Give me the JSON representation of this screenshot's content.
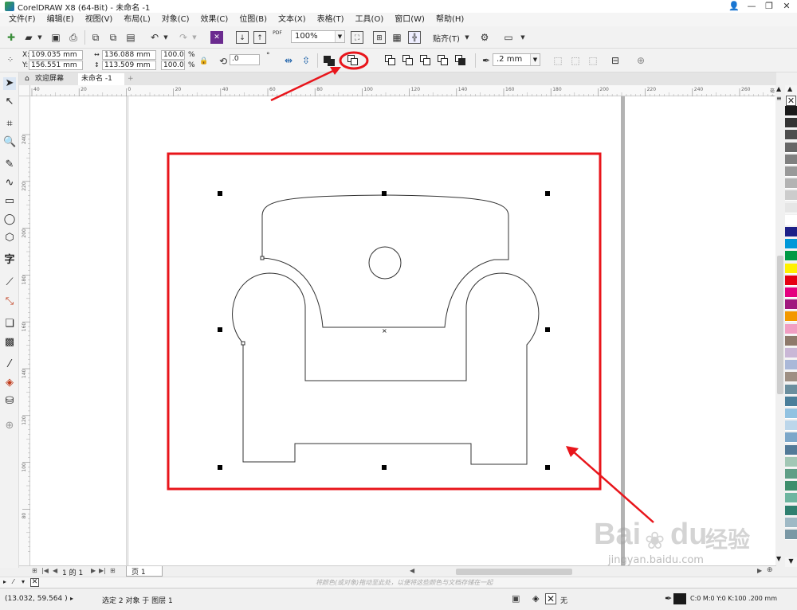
{
  "window": {
    "title": "CorelDRAW X8 (64-Bit) - 未命名 -1",
    "controls": [
      "👤",
      "—",
      "❐",
      "✕"
    ]
  },
  "menu": [
    "文件(F)",
    "编辑(E)",
    "视图(V)",
    "布局(L)",
    "对象(C)",
    "效果(C)",
    "位图(B)",
    "文本(X)",
    "表格(T)",
    "工具(O)",
    "窗口(W)",
    "帮助(H)"
  ],
  "standard_toolbar": {
    "zoom_value": "100%",
    "snap_label": "贴齐(T)",
    "pdf_label": "PDF"
  },
  "property_bar": {
    "x_label": "X:",
    "x_value": "109.035 mm",
    "y_label": "Y:",
    "y_value": "156.551 mm",
    "w_value": "136.088 mm",
    "h_value": "113.509 mm",
    "sx_value": "100.0",
    "sy_value": "100.0",
    "pct": "%",
    "rotation_value": ".0",
    "degree": "°",
    "outline_width": ".2 mm"
  },
  "doc_tabs": {
    "welcome": "欢迎屏幕",
    "document": "未命名 -1",
    "add": "+"
  },
  "ruler_h": [
    "40",
    "20",
    "0",
    "20",
    "40",
    "60",
    "80",
    "100",
    "120",
    "140",
    "160",
    "180",
    "200",
    "220",
    "240",
    "260"
  ],
  "ruler_v": [
    "240",
    "220",
    "200",
    "180",
    "160",
    "140",
    "120",
    "100",
    "80"
  ],
  "ruler_h_unit": "毫米",
  "page_nav": {
    "page_info": "1 的 1",
    "page_tab": "页 1"
  },
  "color_strip_hint": "将颜色(或对象)拖动至此处，以便将这些颜色与文档存储在一起",
  "status": {
    "coords": "(13.032, 59.564 )",
    "selection_text": "选定 2 对象 于 图层 1",
    "fill_none": "无",
    "color_info": "C:0 M:0 Y:0 K:100  .200 mm"
  },
  "watermark": {
    "brand": "Bai",
    "brand2": "du",
    "sub": "经验",
    "url": "jingyan.baidu.com"
  },
  "colors": {
    "annotation_red": "#e8151b",
    "palette": [
      "#1a1a1a",
      "#333333",
      "#4d4d4d",
      "#666666",
      "#808080",
      "#999999",
      "#b3b3b3",
      "#cccccc",
      "#e6e6e6",
      "#ffffff",
      "#1d2088",
      "#0098d8",
      "#009944",
      "#fff100",
      "#e60012",
      "#e4007f",
      "#a0197e",
      "#f39800",
      "#f19ec2",
      "#8e7a6b",
      "#c9b7d6",
      "#aab8d8",
      "#9e8f83",
      "#6b8e9e",
      "#4a7e9a",
      "#92c2e1",
      "#bcd6ea",
      "#7da7c9",
      "#537a98",
      "#a2c7b5",
      "#5f9e86",
      "#3e8e6c",
      "#6eb5a0",
      "#2f7f6f",
      "#9fb9c5",
      "#7a98a5"
    ]
  }
}
